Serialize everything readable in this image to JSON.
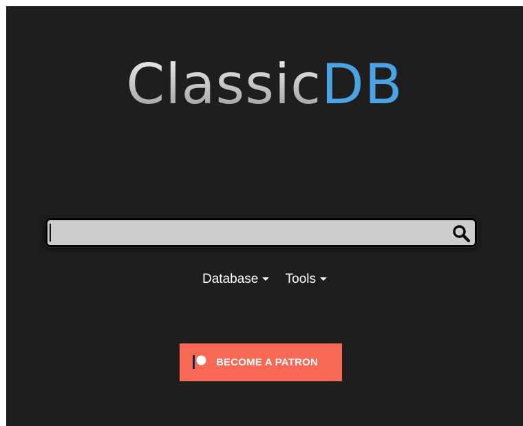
{
  "logo": {
    "part1": "Classic",
    "part2": "DB",
    "part1_color": "#d8d8d8",
    "part2_color": "#4ba3e3"
  },
  "search": {
    "value": "",
    "placeholder": "",
    "icon": "search-icon"
  },
  "nav": {
    "items": [
      {
        "label": "Database",
        "icon": "chevron-down-icon"
      },
      {
        "label": "Tools",
        "icon": "chevron-down-icon"
      }
    ]
  },
  "patron_button": {
    "label": "BECOME A PATRON",
    "icon": "patreon-logo-icon",
    "color": "#f96854"
  },
  "colors": {
    "background": "#1e1e1e",
    "search_field": "#cdcdcd"
  }
}
